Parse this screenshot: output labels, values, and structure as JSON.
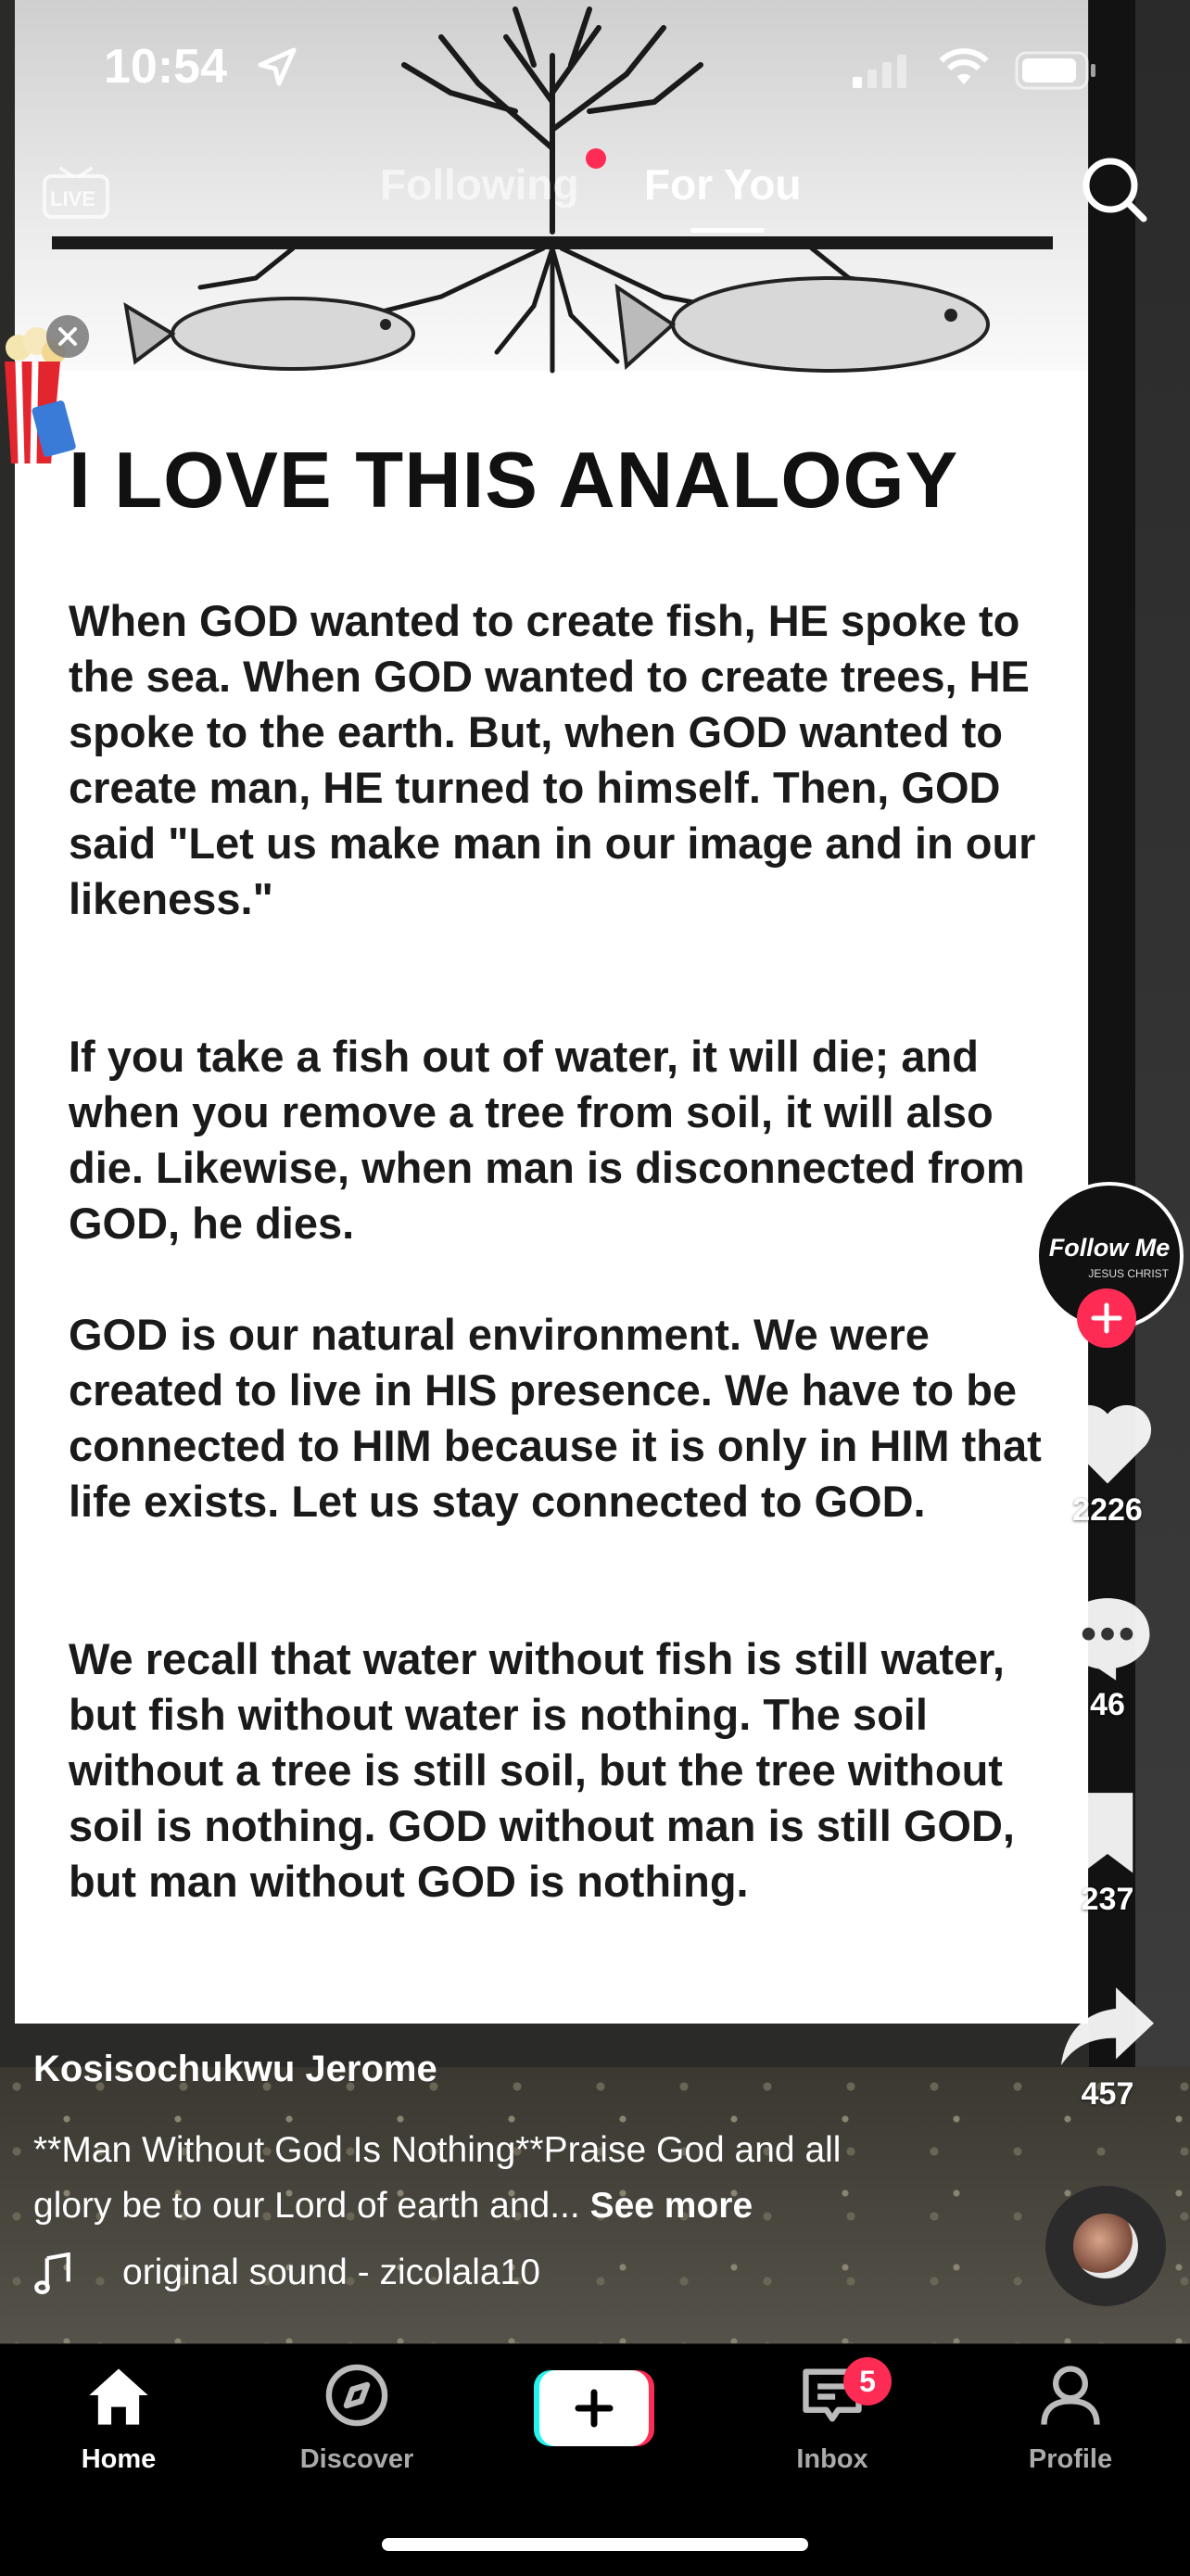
{
  "status_bar": {
    "time": "10:54"
  },
  "top_nav": {
    "live_label": "LIVE",
    "tabs": [
      {
        "label": "Following",
        "active": false
      },
      {
        "label": "For You",
        "active": true
      }
    ]
  },
  "poster": {
    "heading": "I LOVE THIS ANALOGY",
    "paragraphs": [
      "When GOD wanted to create fish, HE spoke to the sea. When GOD wanted to create trees, HE spoke to the earth. But, when GOD wanted to create man, HE turned to himself. Then, GOD said \"Let us make man in our image and in our likeness.\"",
      "If you take a fish out of water, it will die; and when you remove a tree from soil, it will also die. Likewise, when man is disconnected from GOD, he dies.",
      "GOD is our natural environment. We were created to live in HIS presence. We have to be connected to HIM because it is only in HIM that life exists. Let us stay connected to GOD.",
      "We recall that water without fish is still water, but fish without water is nothing. The soil without a tree is still soil, but the tree without soil is nothing. GOD without man is still GOD, but man without GOD is nothing."
    ]
  },
  "sidebar": {
    "avatar_text": "Follow Me",
    "avatar_subtext": "JESUS CHRIST",
    "likes": "2226",
    "comments": "46",
    "saves": "237",
    "shares": "457"
  },
  "post": {
    "author": "Kosisochukwu Jerome",
    "caption": "**Man Without God Is Nothing**Praise God and all glory be to our Lord of earth and...",
    "see_more": "See more",
    "sound": "original sound - zicolala10"
  },
  "tab_bar": {
    "items": [
      {
        "label": "Home",
        "active": true
      },
      {
        "label": "Discover",
        "active": false
      },
      {
        "label": "",
        "active": false
      },
      {
        "label": "Inbox",
        "active": false
      },
      {
        "label": "Profile",
        "active": false
      }
    ],
    "inbox_badge": "5"
  },
  "colors": {
    "accent": "#fe2c55",
    "create_left": "#25f4ee",
    "create_right": "#fe2c55"
  }
}
